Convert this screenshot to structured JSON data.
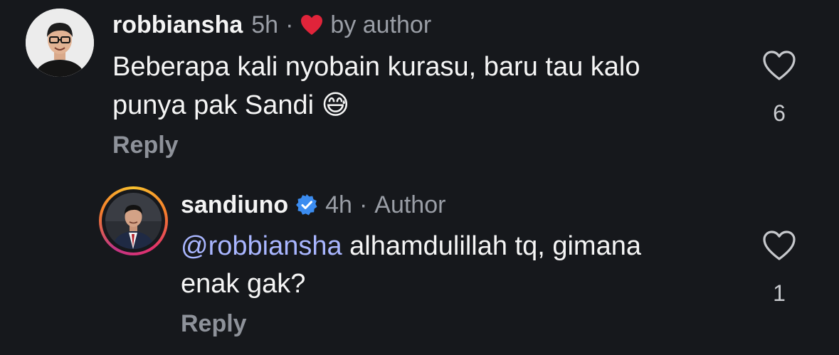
{
  "comment1": {
    "username": "robbiansha",
    "time": "5h",
    "dot": "·",
    "liked_by_author_label": "by author",
    "text_line1": "Beberapa kali nyobain kurasu, baru tau kalo",
    "text_line2": "punya pak Sandi",
    "emoji": "😅",
    "reply_label": "Reply",
    "like_count": "6",
    "heart_color": "#e0243a"
  },
  "comment2": {
    "username": "sandiuno",
    "time": "4h",
    "dot": "·",
    "author_label": "Author",
    "mention": "@robbiansha",
    "text_rest": " alhamdulillah tq, gimana",
    "text_line2": "enak gak?",
    "reply_label": "Reply",
    "like_count": "1",
    "verified_color": "#3b8cf0"
  }
}
